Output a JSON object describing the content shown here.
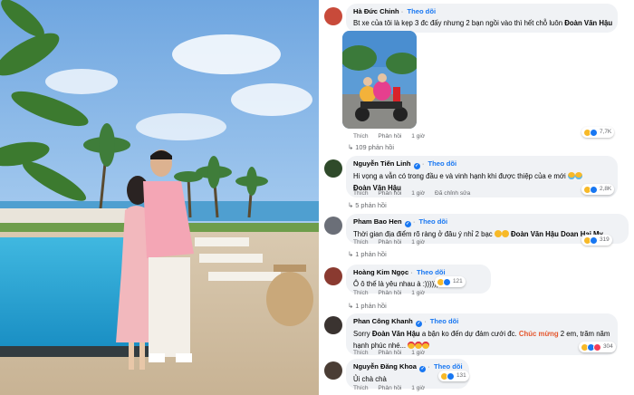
{
  "comments": [
    {
      "name": "Hà Đức Chinh",
      "follow": "Theo dõi",
      "text": "Bt xe của tôi là kẹp 3 đc đấy nhưng 2 bạn ngồi vào thì hết chỗ luôn",
      "mention": "Đoàn Văn Hậu",
      "like": "Thích",
      "reply": "Phản hồi",
      "time": "1 giờ",
      "reaction_count": "7,7K",
      "replies": "109 phản hồi"
    },
    {
      "name": "Nguyễn Tiến Linh",
      "follow": "Theo dõi",
      "text": "Hi vọng a vẫn có trong đầu e và vinh hạnh khi được thiệp của e mới",
      "mention": "Đoàn Văn Hậu",
      "like": "Thích",
      "reply": "Phản hồi",
      "time": "1 giờ",
      "edited": "Đã chỉnh sửa",
      "reaction_count": "2,8K",
      "replies": "5 phản hồi"
    },
    {
      "name": "Pham Bao Hen",
      "follow": "Theo dõi",
      "text": "Thời gian địa điểm rõ ràng ở đâu ý nhỉ 2 bạc",
      "mention": "Đoàn Văn Hậu Doan Hai My",
      "like": "Thích",
      "reply": "Phản hồi",
      "time": "1 giờ",
      "reaction_count": "319",
      "replies": "1 phản hồi"
    },
    {
      "name": "Hoàng Kim Ngọc",
      "follow": "Theo dõi",
      "text": "Ô ô thế là yêu nhau à :))))))",
      "like": "Thích",
      "reply": "Phản hồi",
      "time": "1 giờ",
      "reaction_count": "121",
      "replies": "1 phản hồi"
    },
    {
      "name": "Phan Công Khanh",
      "follow": "Theo dõi",
      "text_before": "Sorry",
      "mention": "Đoàn Văn Hậu",
      "text_mid": "a bận ko đến dự đám cưới đc.",
      "highlight": "Chúc mừng",
      "text_after": "2 em, trăm năm",
      "text_line2": "hạnh phúc nhé...",
      "like": "Thích",
      "reply": "Phản hồi",
      "time": "1 giờ",
      "reaction_count": "304"
    },
    {
      "name": "Nguyễn Đăng Khoa",
      "follow": "Theo dõi",
      "text": "Ủi chà chà",
      "like": "Thích",
      "reply": "Phản hồi",
      "time": "1 giờ",
      "reaction_count": "131"
    }
  ],
  "colors": {
    "accent": "#1877f2",
    "bubble": "#f0f2f5",
    "highlight": "#e4572e"
  }
}
